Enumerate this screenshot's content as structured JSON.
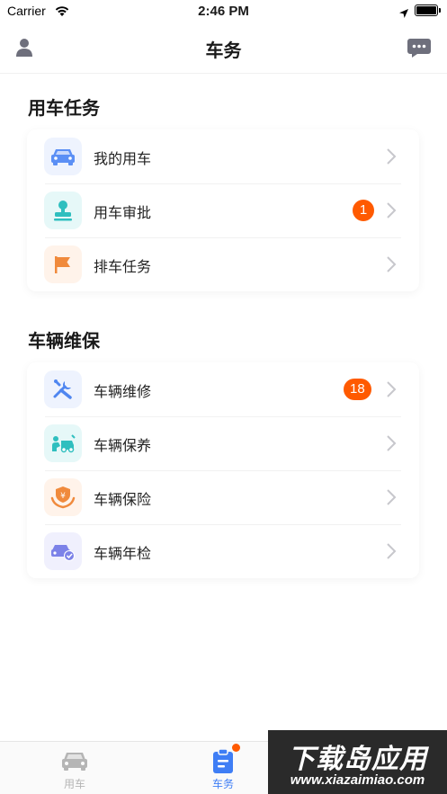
{
  "status": {
    "carrier": "Carrier",
    "time": "2:46 PM",
    "wifi_icon": "wifi-icon",
    "location_icon": "location-arrow-icon",
    "battery_icon": "battery-full-icon"
  },
  "nav": {
    "title": "车务",
    "left_icon": "user-icon",
    "right_icon": "message-icon"
  },
  "sections": [
    {
      "title": "用车任务",
      "items": [
        {
          "label": "我的用车",
          "icon": "car-icon",
          "badge": ""
        },
        {
          "label": "用车审批",
          "icon": "stamp-icon",
          "badge": "1"
        },
        {
          "label": "排车任务",
          "icon": "flag-icon",
          "badge": ""
        }
      ]
    },
    {
      "title": "车辆维保",
      "items": [
        {
          "label": "车辆维修",
          "icon": "repair-tools-icon",
          "badge": "18"
        },
        {
          "label": "车辆保养",
          "icon": "car-maintenance-icon",
          "badge": ""
        },
        {
          "label": "车辆保险",
          "icon": "insurance-hand-icon",
          "badge": ""
        },
        {
          "label": "车辆年检",
          "icon": "car-inspection-icon",
          "badge": ""
        }
      ]
    }
  ],
  "tabs": [
    {
      "label": "用车",
      "icon": "car-icon",
      "active": false
    },
    {
      "label": "车务",
      "icon": "clipboard-icon",
      "active": true
    }
  ],
  "colors": {
    "accent": "#3f7ef5",
    "badge": "#ff5a00",
    "inactive": "#b5b5b5"
  },
  "watermark": {
    "big": "下载岛应用",
    "url": "www.xiazaimiao.com"
  }
}
